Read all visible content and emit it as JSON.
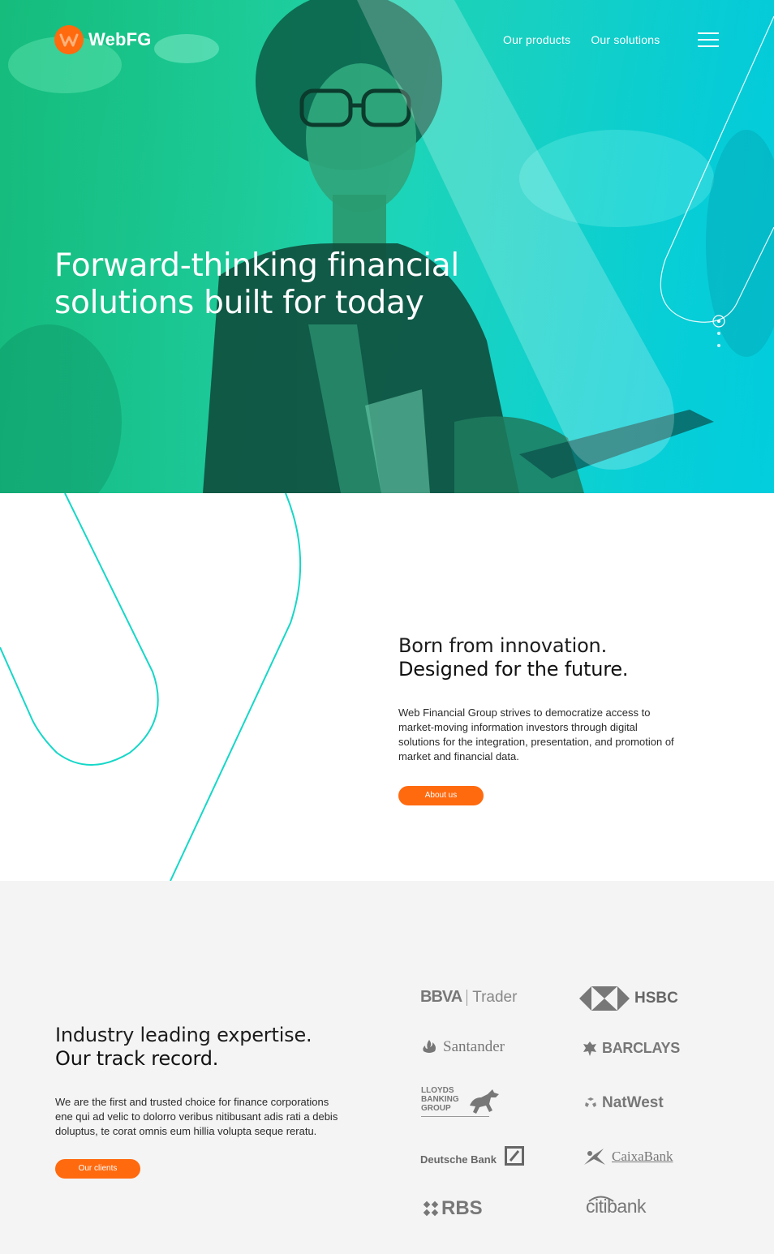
{
  "brand": {
    "name": "WebFG",
    "accent_color": "#ff6a0f",
    "hero_gradient": [
      "#19d48a",
      "#00e0f0"
    ]
  },
  "nav": {
    "links": [
      {
        "label": "Our products"
      },
      {
        "label": "Our solutions"
      }
    ],
    "menu_icon": "hamburger-icon"
  },
  "hero": {
    "headline": "Forward-thinking financial solutions built for today"
  },
  "intro": {
    "title_line1": "Born from innovation.",
    "title_line2": "Designed for the future.",
    "body": "Web Financial Group strives to democratize access to market-moving information investors through digital solutions for the integration, presentation, and promotion of market and financial data.",
    "button_label": "About us"
  },
  "clients": {
    "title_line1": "Industry leading expertise.",
    "title_line2": "Our track record.",
    "body": "We are the first and trusted choice for finance corporations ene qui ad velic to dolorro veribus nitibusant adis rati a debis doluptus, te corat omnis eum hillia volupta seque reratu.",
    "button_label": "Our clients",
    "logos": [
      {
        "name": "BBVA",
        "suffix": "Trader",
        "icon": "bbva-logo"
      },
      {
        "name": "HSBC",
        "icon": "hsbc-hexagon-icon"
      },
      {
        "name": "Santander",
        "icon": "santander-flame-icon"
      },
      {
        "name": "BARCLAYS",
        "icon": "barclays-eagle-icon"
      },
      {
        "name": "LLOYDS BANKING GROUP",
        "line1": "LLOYDS",
        "line2": "BANKING",
        "line3": "GROUP",
        "icon": "lloyds-horse-icon"
      },
      {
        "name": "NatWest",
        "icon": "natwest-cubes-icon"
      },
      {
        "name": "Deutsche Bank",
        "icon": "deutsche-bank-slash-icon"
      },
      {
        "name": "CaixaBank",
        "icon": "caixabank-star-icon"
      },
      {
        "name": "RBS",
        "icon": "rbs-daisy-icon"
      },
      {
        "name": "citibank",
        "icon": "citi-arc-icon"
      }
    ]
  }
}
